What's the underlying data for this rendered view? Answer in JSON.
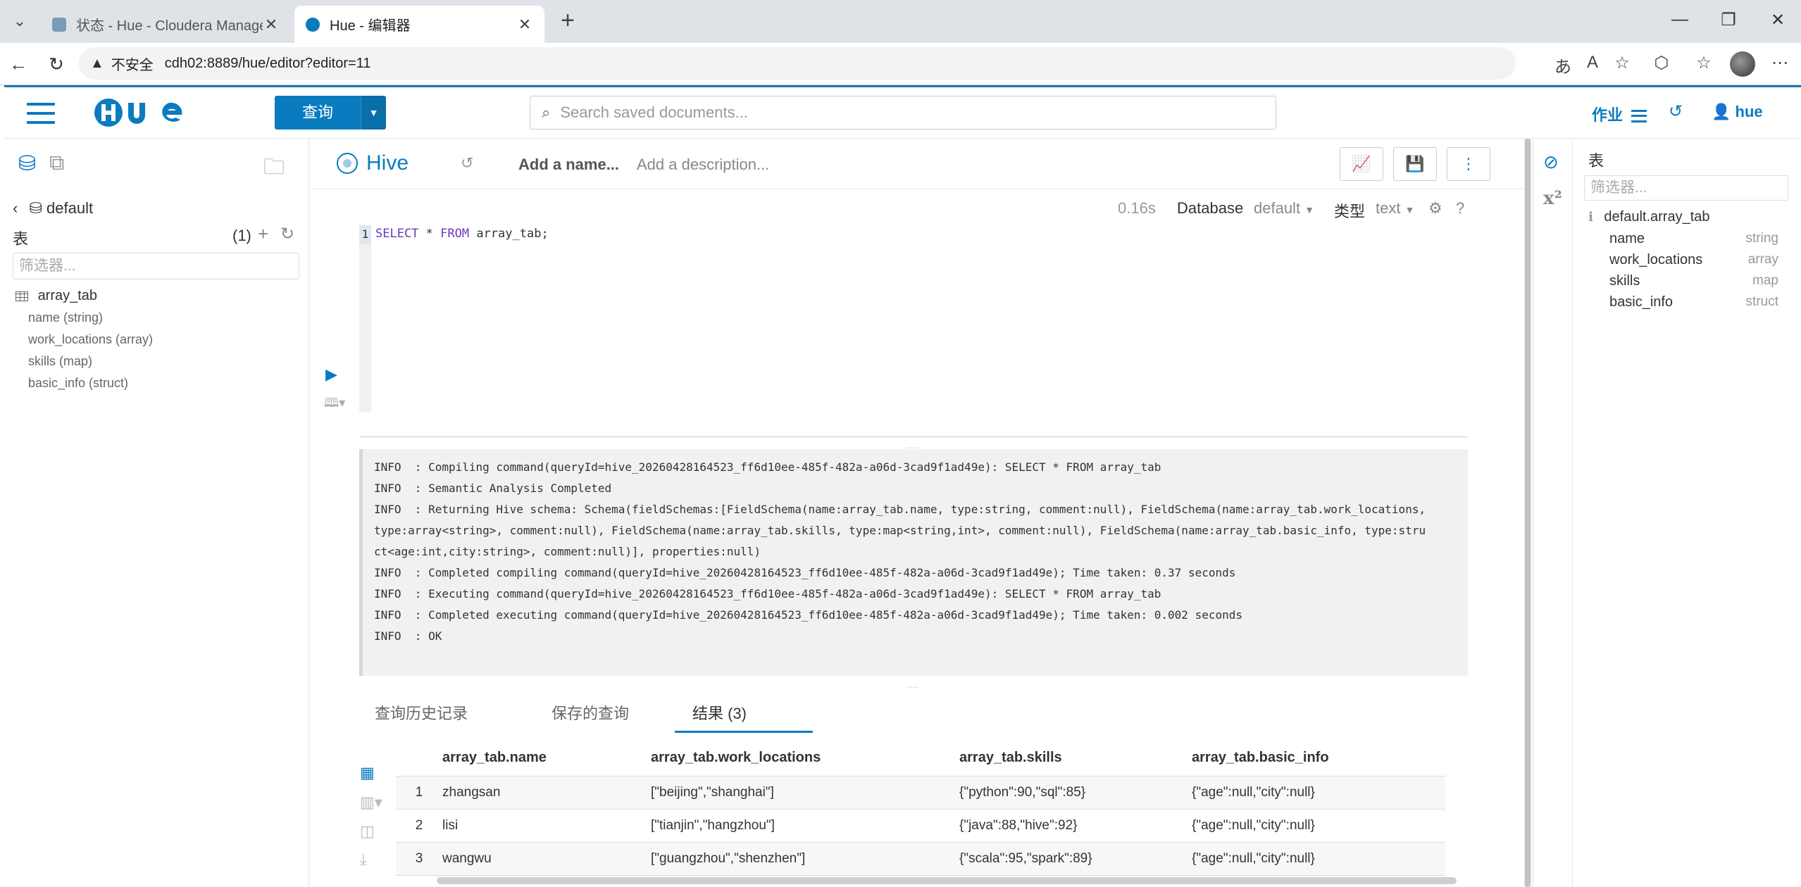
{
  "browser": {
    "tabs": [
      {
        "title": "状态 - Hue - Cloudera Manager",
        "active": false
      },
      {
        "title": "Hue - 编辑器",
        "active": true
      }
    ],
    "address": {
      "security_label": "不安全",
      "url": "cdh02:8889/hue/editor?editor=11"
    }
  },
  "hue_header": {
    "query_button": "查询",
    "search_placeholder": "Search saved documents...",
    "jobs_label": "作业",
    "user_label": "hue"
  },
  "left_panel": {
    "database": "default",
    "tables_heading": "表",
    "table_count": "(1)",
    "filter_placeholder": "筛选器...",
    "table_name": "array_tab",
    "columns": [
      "name (string)",
      "work_locations (array)",
      "skills (map)",
      "basic_info (struct)"
    ]
  },
  "editor": {
    "engine": "Hive",
    "name_placeholder": "Add a name...",
    "description_placeholder": "Add a description...",
    "exec_time": "0.16s",
    "database_label": "Database",
    "database_value": "default",
    "type_label": "类型",
    "type_value": "text",
    "line_number": "1",
    "code_keyword1": "SELECT",
    "code_middle": " * ",
    "code_keyword2": "FROM",
    "code_rest": " array_tab;"
  },
  "log_lines": [
    "INFO  : Compiling command(queryId=hive_20260428164523_ff6d10ee-485f-482a-a06d-3cad9f1ad49e): SELECT * FROM array_tab",
    "INFO  : Semantic Analysis Completed",
    "INFO  : Returning Hive schema: Schema(fieldSchemas:[FieldSchema(name:array_tab.name, type:string, comment:null), FieldSchema(name:array_tab.work_locations,",
    "type:array<string>, comment:null), FieldSchema(name:array_tab.skills, type:map<string,int>, comment:null), FieldSchema(name:array_tab.basic_info, type:stru",
    "ct<age:int,city:string>, comment:null)], properties:null)",
    "INFO  : Completed compiling command(queryId=hive_20260428164523_ff6d10ee-485f-482a-a06d-3cad9f1ad49e); Time taken: 0.37 seconds",
    "INFO  : Executing command(queryId=hive_20260428164523_ff6d10ee-485f-482a-a06d-3cad9f1ad49e): SELECT * FROM array_tab",
    "INFO  : Completed executing command(queryId=hive_20260428164523_ff6d10ee-485f-482a-a06d-3cad9f1ad49e); Time taken: 0.002 seconds",
    "INFO  : OK"
  ],
  "result_tabs": {
    "history": "查询历史记录",
    "saved": "保存的查询",
    "results": "结果 (3)"
  },
  "results": {
    "headers": [
      "array_tab.name",
      "array_tab.work_locations",
      "array_tab.skills",
      "array_tab.basic_info"
    ],
    "rows": [
      {
        "num": "1",
        "name": "zhangsan",
        "work_locations": "[\"beijing\",\"shanghai\"]",
        "skills": "{\"python\":90,\"sql\":85}",
        "basic_info": "{\"age\":null,\"city\":null}"
      },
      {
        "num": "2",
        "name": "lisi",
        "work_locations": "[\"tianjin\",\"hangzhou\"]",
        "skills": "{\"java\":88,\"hive\":92}",
        "basic_info": "{\"age\":null,\"city\":null}"
      },
      {
        "num": "3",
        "name": "wangwu",
        "work_locations": "[\"guangzhou\",\"shenzhen\"]",
        "skills": "{\"scala\":95,\"spark\":89}",
        "basic_info": "{\"age\":null,\"city\":null}"
      }
    ]
  },
  "right_panel": {
    "title": "表",
    "filter_placeholder": "筛选器...",
    "table": "default.array_tab",
    "columns": [
      {
        "name": "name",
        "type": "string"
      },
      {
        "name": "work_locations",
        "type": "array"
      },
      {
        "name": "skills",
        "type": "map"
      },
      {
        "name": "basic_info",
        "type": "struct"
      }
    ]
  },
  "colors": {
    "accent": "#0b7bbf",
    "keyword": "#6c38b8"
  }
}
